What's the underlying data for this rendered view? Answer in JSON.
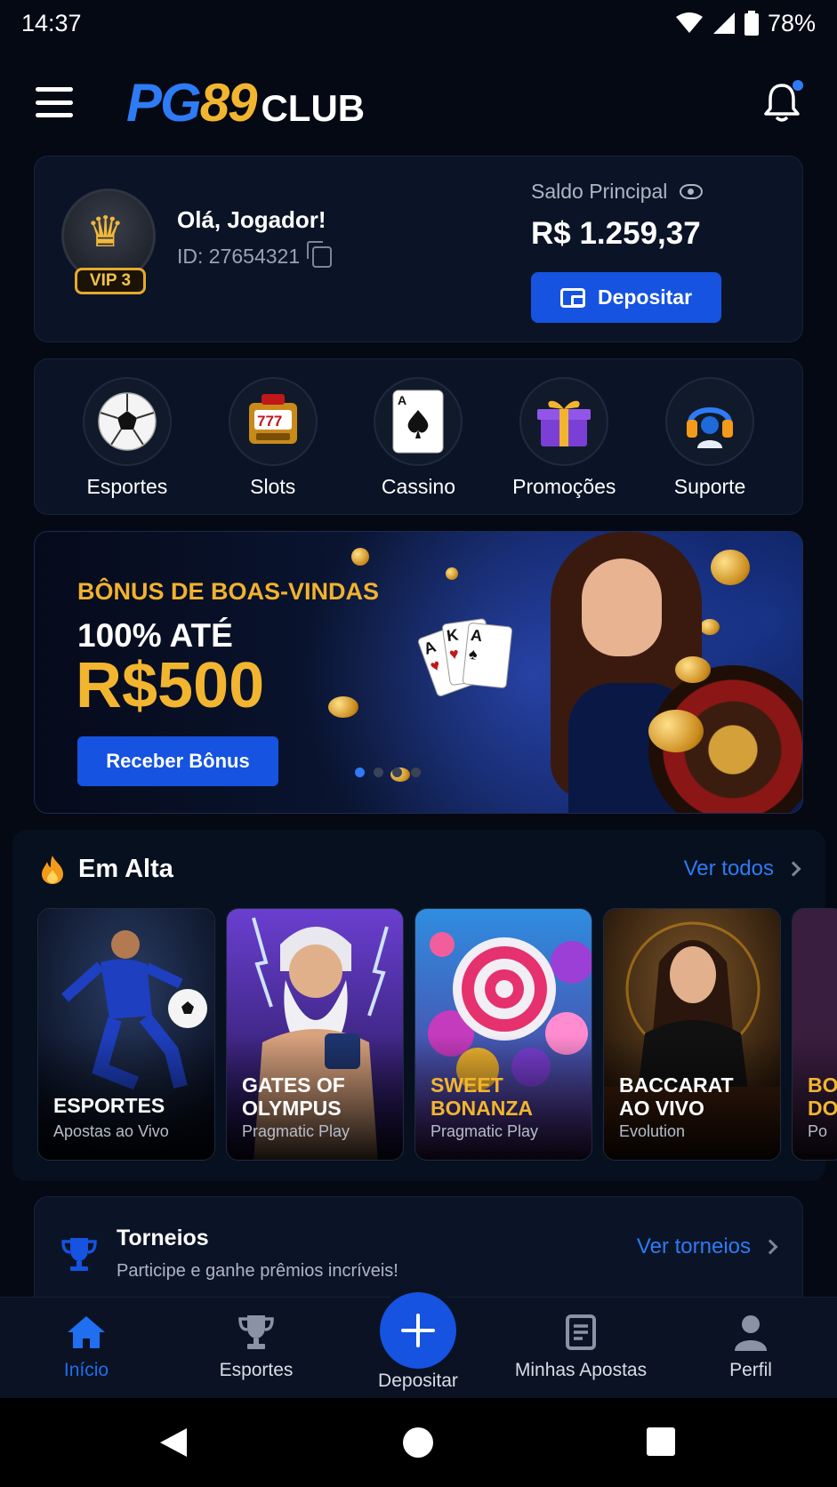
{
  "status_bar": {
    "time": "14:37",
    "battery": "78%"
  },
  "header": {
    "logo_pg": "PG",
    "logo_89": "89",
    "logo_club": "CLUB"
  },
  "profile": {
    "greeting": "Olá, Jogador!",
    "player_id": "ID: 27654321",
    "vip": "VIP 3",
    "balance_label": "Saldo Principal",
    "balance": "R$ 1.259,37",
    "deposit_label": "Depositar"
  },
  "categories": [
    {
      "label": "Esportes",
      "icon": "soccer-ball-icon"
    },
    {
      "label": "Slots",
      "icon": "slot-machine-icon"
    },
    {
      "label": "Cassino",
      "icon": "playing-card-icon"
    },
    {
      "label": "Promoções",
      "icon": "gift-icon"
    },
    {
      "label": "Suporte",
      "icon": "headset-icon"
    }
  ],
  "banner": {
    "kicker": "BÔNUS DE BOAS-VINDAS",
    "line": "100% ATÉ",
    "amount": "R$500",
    "button": "Receber Bônus",
    "slides": 4,
    "active_slide": 1
  },
  "trending": {
    "title": "Em Alta",
    "see_all": "Ver todos",
    "games": [
      {
        "name": "ESPORTES",
        "provider": "Apostas ao Vivo"
      },
      {
        "name": "GATES OF\nOLYMPUS",
        "provider": "Pragmatic Play"
      },
      {
        "name": "SWEET\nBONANZA",
        "provider": "Pragmatic Play"
      },
      {
        "name": "BACCARAT\nAO VIVO",
        "provider": "Evolution"
      },
      {
        "name": "BO\nDO",
        "provider": "Po"
      }
    ]
  },
  "tournaments": {
    "title": "Torneios",
    "subtitle": "Participe e ganhe prêmios incríveis!",
    "link": "Ver torneios"
  },
  "bottom_nav": {
    "home": "Início",
    "sports": "Esportes",
    "deposit": "Depositar",
    "my_bets": "Minhas Apostas",
    "profile": "Perfil"
  },
  "colors": {
    "accent": "#1553e0",
    "gold": "#f2b530",
    "background": "#050914"
  }
}
